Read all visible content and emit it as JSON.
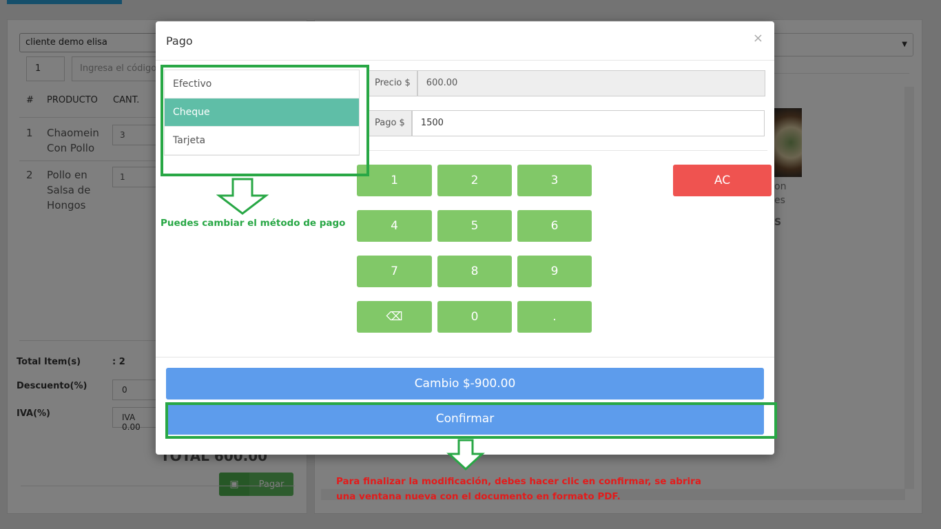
{
  "background": {
    "client": "cliente demo elisa",
    "qty_value": "1",
    "code_placeholder": "Ingresa el código",
    "table_headers": {
      "num": "#",
      "product": "PRODUCTO",
      "qty": "CANT."
    },
    "rows": [
      {
        "num": "1",
        "product": "Chaomein Con Pollo",
        "qty": "3"
      },
      {
        "num": "2",
        "product": "Pollo en Salsa de Hongos",
        "qty": "1"
      }
    ],
    "summary": {
      "items_label": "Total Item(s)",
      "items_value": ": 2",
      "discount_label": "Descuento(%)",
      "discount_value": "0",
      "tax_label": "IVA(%)",
      "tax_value": "IVA 0.00",
      "total_text": "TOTAL     600.00"
    },
    "pay_button": "Pagar",
    "right_partial": {
      "line1": "on",
      "line2": "es",
      "line3": "S"
    }
  },
  "modal": {
    "title": "Pago",
    "close": "×",
    "methods": [
      {
        "label": "Efectivo",
        "active": false
      },
      {
        "label": "Cheque",
        "active": true
      },
      {
        "label": "Tarjeta",
        "active": false
      }
    ],
    "price_label": "Precio $",
    "price_value": "600.00",
    "payment_label": "Pago $",
    "payment_value": "1500",
    "keypad": {
      "k1": "1",
      "k2": "2",
      "k3": "3",
      "k4": "4",
      "k5": "5",
      "k6": "6",
      "k7": "7",
      "k8": "8",
      "k9": "9",
      "kback": "⌫",
      "k0": "0",
      "kdot": ".",
      "kac": "AC"
    },
    "change_button": "Cambio $-900.00",
    "confirm_button": "Confirmar"
  },
  "annotations": {
    "methods_note": "Puedes cambiar el método de pago",
    "confirm_note_line1": "Para finalizar la modificación, debes hacer clic en confirmar, se abrira",
    "confirm_note_line2": "una ventana nueva con el documento en formato PDF."
  },
  "colors": {
    "accent_green": "#28a745",
    "method_active": "#5fbea7",
    "keypad": "#81c868",
    "clear_key": "#ef5350",
    "primary_button": "#5d9cec",
    "annotation_red": "#e31b1b"
  }
}
